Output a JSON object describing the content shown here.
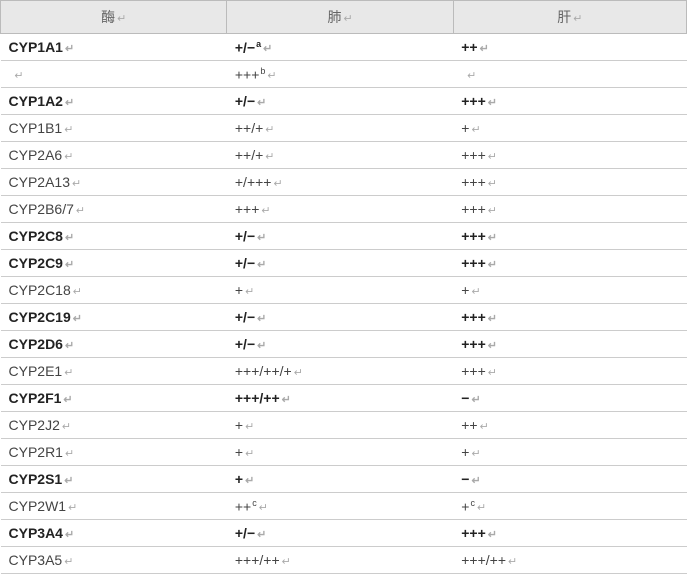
{
  "chart_data": {
    "type": "table",
    "headers": [
      "酶",
      "肺",
      "肝"
    ],
    "rows": [
      {
        "enzyme": "CYP1A1",
        "lung": "+/−",
        "lung_sup": "a",
        "liver": "++",
        "bold": true
      },
      {
        "enzyme": "",
        "lung": "+++",
        "lung_sup": "b",
        "liver": "",
        "bold": false
      },
      {
        "enzyme": "CYP1A2",
        "lung": "+/−",
        "liver": "+++",
        "bold": true
      },
      {
        "enzyme": "CYP1B1",
        "lung": "++/+",
        "liver": "+",
        "bold": false
      },
      {
        "enzyme": "CYP2A6",
        "lung": "++/+",
        "liver": "+++",
        "bold": false
      },
      {
        "enzyme": "CYP2A13",
        "lung": "+/+++",
        "liver": "+++",
        "bold": false
      },
      {
        "enzyme": "CYP2B6/7",
        "lung": "+++",
        "liver": "+++",
        "bold": false
      },
      {
        "enzyme": "CYP2C8",
        "lung": "+/−",
        "liver": "+++",
        "bold": true
      },
      {
        "enzyme": "CYP2C9",
        "lung": "+/−",
        "liver": "+++",
        "bold": true
      },
      {
        "enzyme": "CYP2C18",
        "lung": "+",
        "liver": "+",
        "bold": false
      },
      {
        "enzyme": "CYP2C19",
        "lung": "+/−",
        "liver": "+++",
        "bold": true
      },
      {
        "enzyme": "CYP2D6",
        "lung": "+/−",
        "liver": "+++",
        "bold": true
      },
      {
        "enzyme": "CYP2E1",
        "lung": "+++/++/+",
        "liver": "+++",
        "bold": false
      },
      {
        "enzyme": "CYP2F1",
        "lung": "+++/++",
        "liver": "−",
        "bold": true
      },
      {
        "enzyme": "CYP2J2",
        "lung": "+",
        "liver": "++",
        "bold": false
      },
      {
        "enzyme": "CYP2R1",
        "lung": "+",
        "liver": "+",
        "bold": false
      },
      {
        "enzyme": "CYP2S1",
        "lung": "+",
        "liver": "−",
        "bold": true
      },
      {
        "enzyme": "CYP2W1",
        "lung": "++",
        "lung_sup": "c",
        "liver": "+",
        "liver_sup": "c",
        "bold": false
      },
      {
        "enzyme": "CYP3A4",
        "lung": "+/−",
        "liver": "+++",
        "bold": true
      },
      {
        "enzyme": "CYP3A5",
        "lung": "+++/++",
        "liver": "+++/++",
        "bold": false
      }
    ]
  },
  "return_glyph": "↵"
}
